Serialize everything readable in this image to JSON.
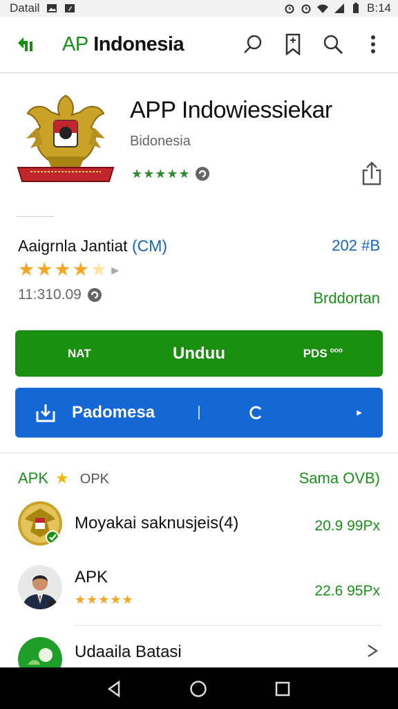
{
  "status_bar": {
    "left_text": "Datail",
    "time": "B:14",
    "icons": [
      "gallery-icon",
      "notification-icon",
      "alarm-icon",
      "alarm-icon",
      "wifi-icon",
      "signal-icon",
      "battery-icon"
    ]
  },
  "app_bar": {
    "title_prefix": "AP",
    "title_main": "Indonesia",
    "actions": [
      "search-outline-icon",
      "bookmark-icon",
      "search-icon",
      "more-vert-icon"
    ]
  },
  "hero": {
    "title": "APP Indowiessiekar",
    "subtitle": "Bidonesia",
    "stars": "★★★★★"
  },
  "rating_section": {
    "title_main": "Aaigrnla Jantiat",
    "title_suffix": "(CM)",
    "size": "202 #B",
    "stars_full": 4,
    "stars_total": 5,
    "time": "11:310.09",
    "link": "Brddortan"
  },
  "green_bar": {
    "left": "NAT",
    "center": "Unduu",
    "right": "PDS",
    "right_small": "ooo"
  },
  "blue_bar": {
    "label": "Padomesa",
    "refresh_label": "C"
  },
  "list_header": {
    "apk": "APK",
    "sub": "OPK",
    "right": "Sama OVB)"
  },
  "list_items": [
    {
      "title": "Moyakai saknusjeis(4)",
      "value": "20.9 99Px"
    },
    {
      "title": "APK",
      "stars": "★★★★★",
      "value": "22.6 95Px"
    },
    {
      "title": "Udaaila Batasi"
    }
  ],
  "colors": {
    "green": "#1a8e0f",
    "blue": "#1468d6",
    "star": "#f5a623",
    "link_blue": "#1565c0"
  }
}
